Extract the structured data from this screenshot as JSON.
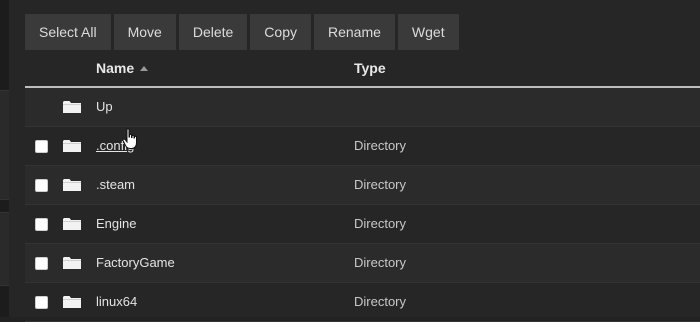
{
  "toolbar": {
    "buttons": [
      "Select All",
      "Move",
      "Delete",
      "Copy",
      "Rename",
      "Wget"
    ]
  },
  "table": {
    "headers": {
      "name": "Name",
      "type": "Type"
    },
    "sort_icon": "sort-ascending-icon",
    "up_row": {
      "name": "Up"
    },
    "rows": [
      {
        "name": ".config",
        "type": "Directory"
      },
      {
        "name": ".steam",
        "type": "Directory"
      },
      {
        "name": "Engine",
        "type": "Directory"
      },
      {
        "name": "FactoryGame",
        "type": "Directory"
      },
      {
        "name": "linux64",
        "type": "Directory"
      }
    ]
  },
  "icons": {
    "folder": "folder-icon",
    "cursor": "hand-cursor-icon"
  },
  "colors": {
    "background": "#262626",
    "button": "#3a3a3a",
    "header_rule": "#bdbdbd"
  }
}
